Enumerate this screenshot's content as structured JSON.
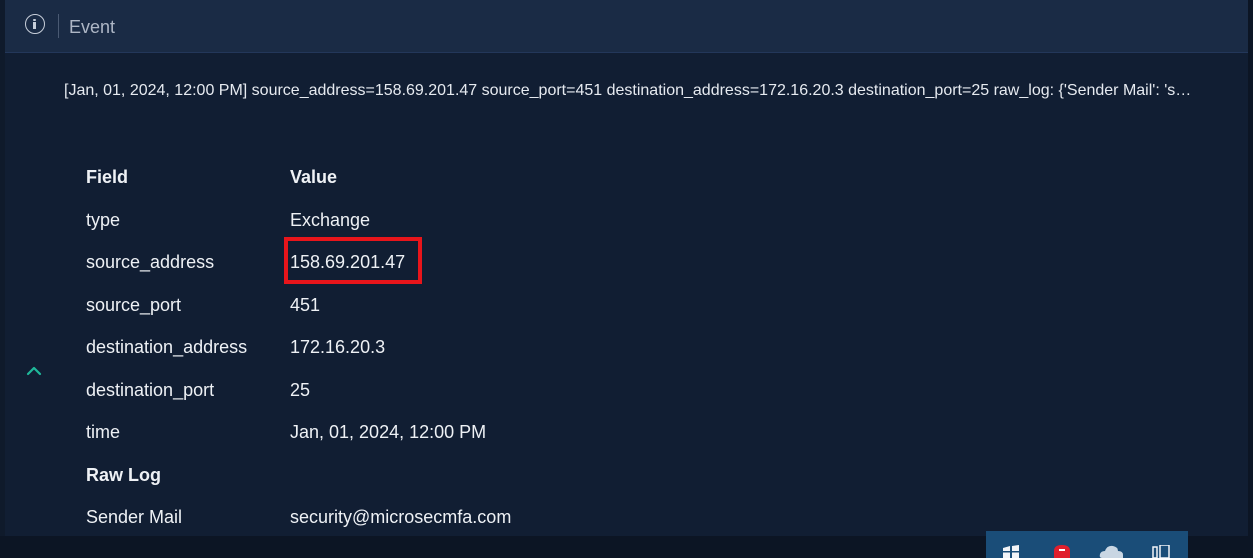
{
  "header": {
    "title": "Event",
    "info_icon": "info-icon"
  },
  "summary": "[Jan, 01, 2024, 12:00 PM] source_address=158.69.201.47 source_port=451 destination_address=172.16.20.3 destination_port=25 raw_log: {'Sender Mail': 's…",
  "table": {
    "columns": {
      "field": "Field",
      "value": "Value"
    },
    "rows": [
      {
        "field": "type",
        "value": "Exchange"
      },
      {
        "field": "source_address",
        "value": "158.69.201.47"
      },
      {
        "field": "source_port",
        "value": "451"
      },
      {
        "field": "destination_address",
        "value": "172.16.20.3"
      },
      {
        "field": "destination_port",
        "value": "25"
      },
      {
        "field": "time",
        "value": "Jan, 01, 2024, 12:00 PM"
      }
    ],
    "raw_log_heading": "Raw Log",
    "raw_log_rows": [
      {
        "field": "Sender Mail",
        "value": "security@microsecmfa.com"
      }
    ]
  },
  "colors": {
    "background": "#111e33",
    "header": "#1a2b45",
    "accent": "#1fb89a",
    "highlight": "#e8151b",
    "text": "#eef1f5"
  },
  "icons": {
    "collapse": "chevron-up-icon",
    "tray": [
      "windows-security-icon",
      "app-shield-icon",
      "onedrive-cloud-icon",
      "network-icon"
    ]
  }
}
